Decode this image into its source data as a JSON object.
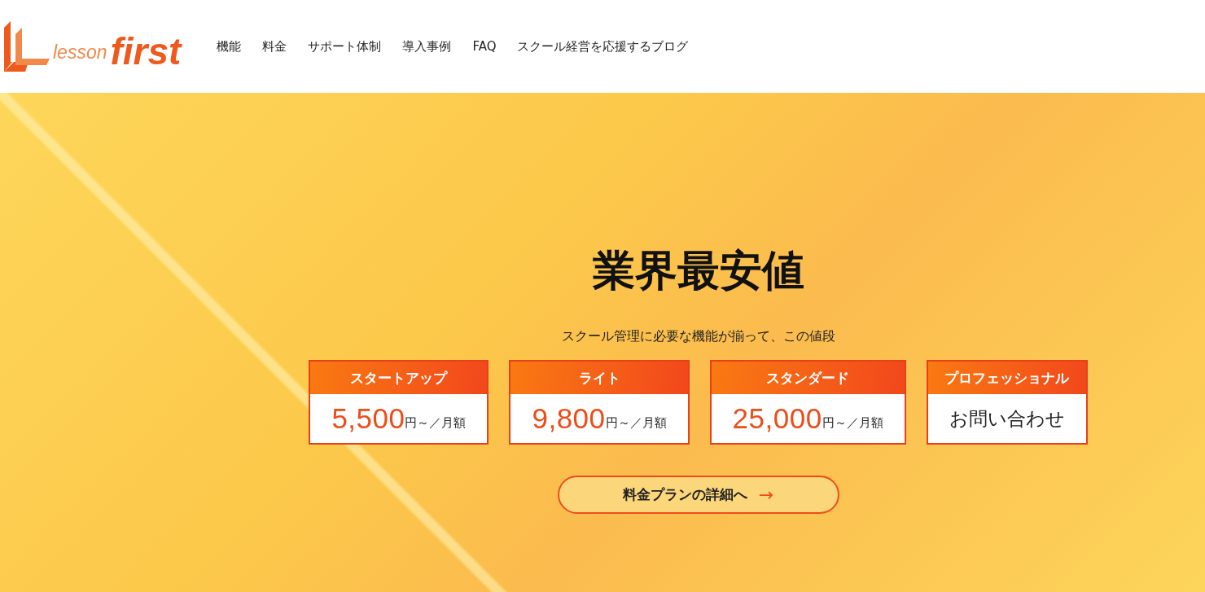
{
  "header": {
    "logo": {
      "word_1": "lesson",
      "word_2": "first"
    },
    "nav": [
      {
        "label": "機能"
      },
      {
        "label": "料金"
      },
      {
        "label": "サポート体制"
      },
      {
        "label": "導入事例"
      },
      {
        "label": "FAQ"
      },
      {
        "label": "スクール経営を応援するブログ"
      }
    ]
  },
  "hero": {
    "title": "業界最安値",
    "subtitle": "スクール管理に必要な機能が揃って、この値段",
    "plans": [
      {
        "kind": "price",
        "name": "スタートアップ",
        "amount": "5,500",
        "unit": "円～／月額"
      },
      {
        "kind": "price",
        "name": "ライト",
        "amount": "9,800",
        "unit": "円～／月額"
      },
      {
        "kind": "price",
        "name": "スタンダード",
        "amount": "25,000",
        "unit": "円～／月額"
      },
      {
        "kind": "contact",
        "name": "プロフェッショナル",
        "text": "お問い合わせ"
      }
    ],
    "button": {
      "label": "料金プランの詳細へ",
      "arrow": "→"
    }
  }
}
